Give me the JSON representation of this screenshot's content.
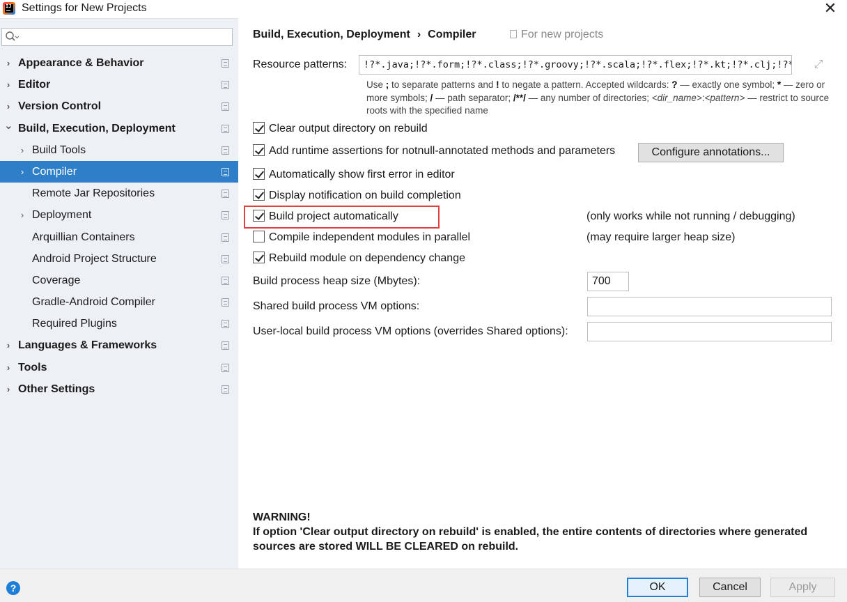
{
  "window": {
    "title": "Settings for New Projects",
    "close": "✕"
  },
  "search": {
    "placeholder": "",
    "icon": "search-icon"
  },
  "sidebar": {
    "items": [
      {
        "label": "Appearance & Behavior",
        "level": 0,
        "bold": true,
        "arrow": "›",
        "selected": false
      },
      {
        "label": "Editor",
        "level": 0,
        "bold": true,
        "arrow": "›",
        "selected": false
      },
      {
        "label": "Version Control",
        "level": 0,
        "bold": true,
        "arrow": "›",
        "selected": false
      },
      {
        "label": "Build, Execution, Deployment",
        "level": 0,
        "bold": true,
        "arrow": "⌄",
        "selected": false
      },
      {
        "label": "Build Tools",
        "level": 1,
        "bold": false,
        "arrow": "›",
        "selected": false
      },
      {
        "label": "Compiler",
        "level": 1,
        "bold": false,
        "arrow": "›",
        "selected": true
      },
      {
        "label": "Remote Jar Repositories",
        "level": 1,
        "bold": false,
        "arrow": "",
        "selected": false
      },
      {
        "label": "Deployment",
        "level": 1,
        "bold": false,
        "arrow": "›",
        "selected": false
      },
      {
        "label": "Arquillian Containers",
        "level": 1,
        "bold": false,
        "arrow": "",
        "selected": false
      },
      {
        "label": "Android Project Structure",
        "level": 1,
        "bold": false,
        "arrow": "",
        "selected": false
      },
      {
        "label": "Coverage",
        "level": 1,
        "bold": false,
        "arrow": "",
        "selected": false
      },
      {
        "label": "Gradle-Android Compiler",
        "level": 1,
        "bold": false,
        "arrow": "",
        "selected": false
      },
      {
        "label": "Required Plugins",
        "level": 1,
        "bold": false,
        "arrow": "",
        "selected": false
      },
      {
        "label": "Languages & Frameworks",
        "level": 0,
        "bold": true,
        "arrow": "›",
        "selected": false
      },
      {
        "label": "Tools",
        "level": 0,
        "bold": true,
        "arrow": "›",
        "selected": false
      },
      {
        "label": "Other Settings",
        "level": 0,
        "bold": true,
        "arrow": "›",
        "selected": false
      }
    ]
  },
  "header": {
    "crumb1": "Build, Execution, Deployment",
    "separator": "›",
    "crumb2": "Compiler",
    "scope": "For new projects"
  },
  "resource": {
    "label": "Resource patterns:",
    "value": "!?*.java;!?*.form;!?*.class;!?*.groovy;!?*.scala;!?*.flex;!?*.kt;!?*.clj;!?*.aj",
    "help_line1_a": "Use ",
    "help_line1_b": ";",
    "help_line1_c": " to separate patterns and ",
    "help_line1_d": "!",
    "help_line1_e": " to negate a pattern. Accepted wildcards: ",
    "help_line1_f": "?",
    "help_line1_g": " — exactly one symbol; ",
    "help_line1_h": "*",
    "help_line1_i": " — zero or more symbols; ",
    "help_line1_j": "/",
    "help_line1_k": " — path separator; ",
    "help_line1_l": "/**/",
    "help_line1_m": " — any number of directories; ",
    "help_line1_n": "<dir_name>",
    "help_line1_o": ":",
    "help_line1_p": "<pattern>",
    "help_line1_q": " — restrict to source roots with the specified name"
  },
  "options": {
    "clear_output": {
      "label": "Clear output directory on rebuild",
      "checked": true
    },
    "runtime_assertions": {
      "label": "Add runtime assertions for notnull-annotated methods and parameters",
      "checked": true
    },
    "configure_annotations": "Configure annotations...",
    "show_first_error": {
      "label": "Automatically show first error in editor",
      "checked": true
    },
    "display_notification": {
      "label": "Display notification on build completion",
      "checked": true
    },
    "build_automatically": {
      "label": "Build project automatically",
      "checked": true,
      "note": "(only works while not running / debugging)"
    },
    "compile_parallel": {
      "label": "Compile independent modules in parallel",
      "checked": false,
      "note": "(may require larger heap size)"
    },
    "rebuild_on_dependency": {
      "label": "Rebuild module on dependency change",
      "checked": true
    }
  },
  "fields": {
    "heap_label": "Build process heap size (Mbytes):",
    "heap_value": "700",
    "shared_vm_label": "Shared build process VM options:",
    "shared_vm_value": "",
    "user_vm_label": "User-local build process VM options (overrides Shared options):",
    "user_vm_value": ""
  },
  "warning": {
    "title": "WARNING!",
    "body": "If option 'Clear output directory on rebuild' is enabled, the entire contents of directories where generated sources are stored WILL BE CLEARED on rebuild."
  },
  "footer": {
    "help": "?",
    "ok": "OK",
    "cancel": "Cancel",
    "apply": "Apply"
  },
  "colors": {
    "selection": "#2f7fc8",
    "highlight": "#e0413e",
    "sidebar_bg": "#edf1f6"
  }
}
